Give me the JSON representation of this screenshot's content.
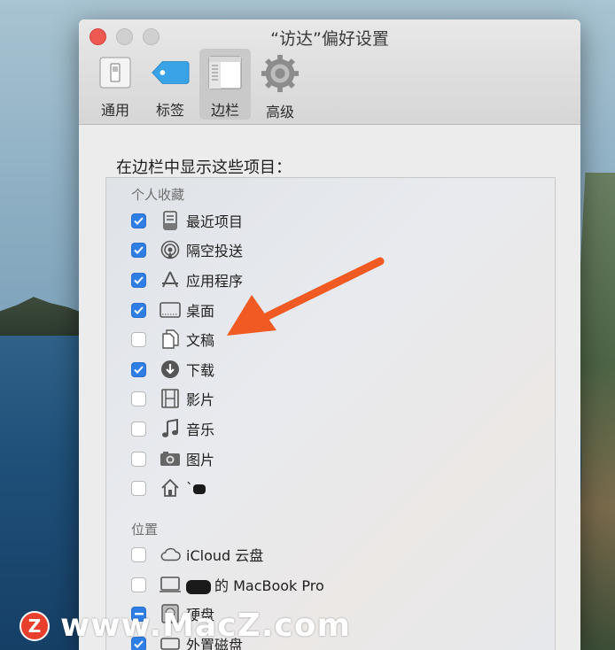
{
  "window": {
    "title": "“访达”偏好设置"
  },
  "toolbar": {
    "tabs": [
      {
        "label": "通用",
        "icon": "switch-icon"
      },
      {
        "label": "标签",
        "icon": "tag-icon"
      },
      {
        "label": "边栏",
        "icon": "sidebar-icon"
      },
      {
        "label": "高级",
        "icon": "gear-icon"
      }
    ],
    "active": "边栏"
  },
  "sidebar_settings": {
    "heading": "在边栏中显示这些项目：",
    "favorites": {
      "title": "个人收藏",
      "items": [
        {
          "label": "最近项目",
          "checked": true,
          "icon": "recents-icon"
        },
        {
          "label": "隔空投送",
          "checked": true,
          "icon": "airdrop-icon"
        },
        {
          "label": "应用程序",
          "checked": true,
          "icon": "applications-icon"
        },
        {
          "label": "桌面",
          "checked": true,
          "icon": "desktop-icon"
        },
        {
          "label": "文稿",
          "checked": false,
          "icon": "documents-icon"
        },
        {
          "label": "下载",
          "checked": true,
          "icon": "downloads-icon"
        },
        {
          "label": "影片",
          "checked": false,
          "icon": "movies-icon"
        },
        {
          "label": "音乐",
          "checked": false,
          "icon": "music-icon"
        },
        {
          "label": "图片",
          "checked": false,
          "icon": "pictures-icon"
        },
        {
          "label": "`",
          "checked": false,
          "icon": "home-icon"
        }
      ]
    },
    "locations": {
      "title": "位置",
      "items": [
        {
          "label": "iCloud 云盘",
          "checked": false,
          "icon": "icloud-icon"
        },
        {
          "label": "的 MacBook Pro",
          "checked": false,
          "icon": "computer-icon"
        },
        {
          "label": "硬盘",
          "checked": "mixed",
          "icon": "harddisk-icon"
        },
        {
          "label": "外置磁盘",
          "checked": true,
          "icon": "external-disk-icon"
        }
      ]
    }
  },
  "colors": {
    "accent": "#2f7ee6",
    "arrow": "#f25a24",
    "close": "#ee5a52"
  },
  "watermark": {
    "logo": "Z",
    "text": "www.MacZ.com"
  }
}
